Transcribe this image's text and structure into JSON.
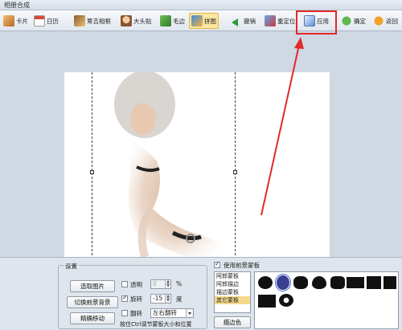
{
  "window": {
    "title": "相册合成"
  },
  "toolbar": {
    "items": [
      {
        "label": "卡片",
        "icon": "card-icon"
      },
      {
        "label": "日历",
        "icon": "calendar-icon"
      },
      {
        "label": "筹吉相框",
        "icon": "palace-frame-icon"
      },
      {
        "label": "大头贴",
        "icon": "big-head-sticker-icon"
      },
      {
        "label": "毛边",
        "icon": "rough-edge-icon"
      },
      {
        "label": "拼图",
        "icon": "puzzle-icon",
        "active": true
      },
      {
        "label": "撤销",
        "icon": "undo-arrow-icon"
      },
      {
        "label": "重定位",
        "icon": "reposition-icon"
      },
      {
        "label": "应用",
        "icon": "apply-icon",
        "highlighted": true
      },
      {
        "label": "确定",
        "icon": "ok-icon"
      },
      {
        "label": "返回",
        "icon": "back-icon"
      }
    ]
  },
  "settings": {
    "title": "设置",
    "buttons": {
      "select_image": "选取图片",
      "switch_bg": "切换前景背景",
      "fine_move": "精确移动"
    },
    "transparency": {
      "label": "透明",
      "value": "0",
      "unit": "%",
      "checked": false
    },
    "rotate": {
      "label": "旋转",
      "value": "-15",
      "unit": "度",
      "checked": true
    },
    "flip": {
      "label": "翻转",
      "value": "左右翻转",
      "checked": false
    },
    "hint": "按住Ctrl调节蒙板大小和位置"
  },
  "mask": {
    "title": "使用前景蒙板",
    "checked": true,
    "list": [
      "阿郎蒙板",
      "阿郎描边",
      "描边蒙板",
      "其它蒙板"
    ],
    "selected_index": 3,
    "stroke_color_label": "描边色"
  },
  "colors": {
    "highlight": "#e02a2a",
    "active_tool": "#fde7a3",
    "selection": "#f5d98b"
  }
}
